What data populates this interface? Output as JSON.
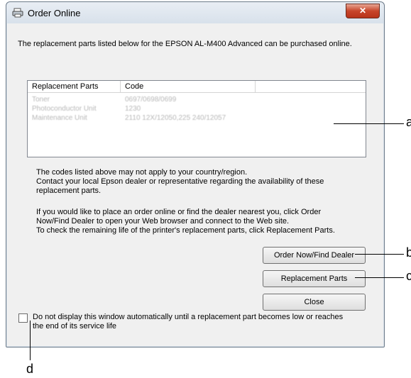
{
  "window": {
    "title": "Order Online",
    "close_symbol": "✕"
  },
  "intro": {
    "text": "The replacement parts listed below for the EPSON AL-M400 Advanced can be purchased online."
  },
  "table": {
    "columns": [
      "Replacement Parts",
      "Code"
    ],
    "rows": [
      {
        "part": "Toner",
        "code": "0697/0698/0699"
      },
      {
        "part": "Photoconductor Unit",
        "code": "1230"
      },
      {
        "part": "Maintenance Unit",
        "code": "2110 12X/12050,225 240/12057"
      }
    ]
  },
  "notes": {
    "line1": "The codes listed above may not apply to your country/region.",
    "line2": "Contact your local Epson dealer or representative regarding the availability of these",
    "line3": "replacement parts.",
    "line4": "If you would like to place an order online or find the dealer nearest you, click Order",
    "line5": "Now/Find Dealer to open your Web browser and connect to the Web site.",
    "line6": "To check the remaining life of the printer's replacement parts, click Replacement Parts."
  },
  "buttons": {
    "order": "Order Now/Find Dealer",
    "replacement": "Replacement Parts",
    "close": "Close"
  },
  "checkbox": {
    "label_line1": "Do not display this window automatically until a replacement part becomes low or reaches",
    "label_line2": "the end of its service life",
    "checked": false
  },
  "callouts": {
    "a": "a",
    "b": "b",
    "c": "c",
    "d": "d"
  }
}
